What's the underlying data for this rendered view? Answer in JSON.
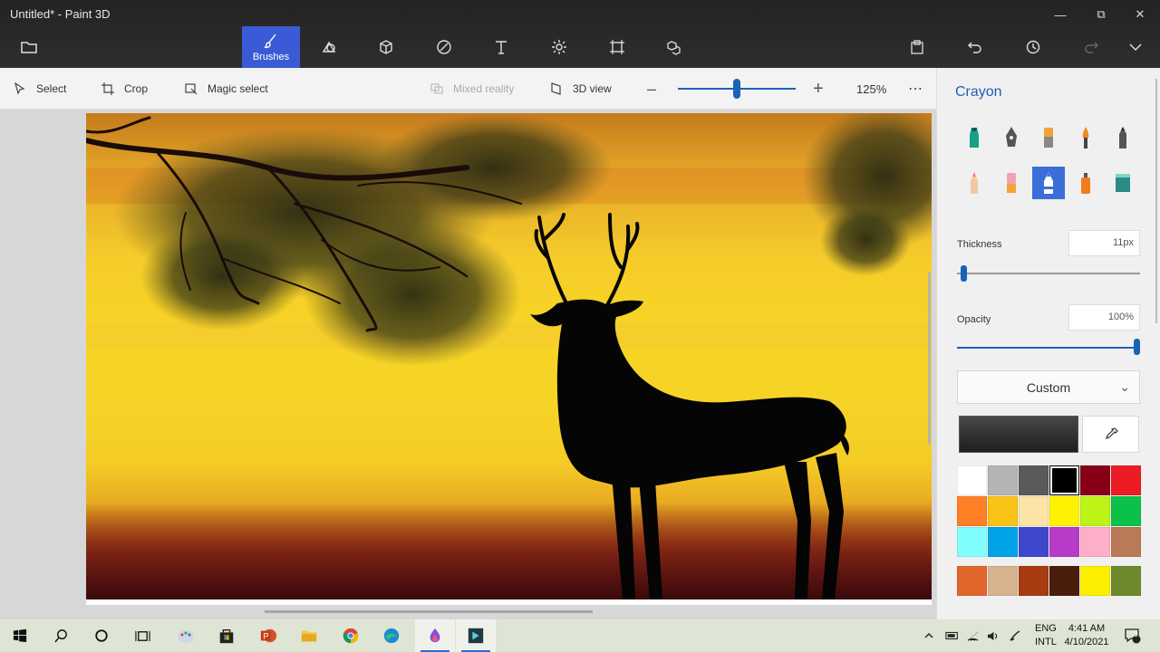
{
  "window": {
    "title": "Untitled* - Paint 3D"
  },
  "toolbar": {
    "brushes_label": "Brushes"
  },
  "subbar": {
    "select": "Select",
    "crop": "Crop",
    "magic_select": "Magic select",
    "mixed_reality": "Mixed reality",
    "view_3d": "3D view",
    "zoom_level": "125%",
    "zoom_fraction": 0.5
  },
  "panel": {
    "title": "Crayon",
    "thickness_label": "Thickness",
    "thickness_value": "11px",
    "thickness_fraction": 0.02,
    "opacity_label": "Opacity",
    "opacity_value": "100%",
    "opacity_fraction": 1.0,
    "palette_dropdown": "Custom",
    "selected_brush": "crayon",
    "current_color": "#1e1e1e",
    "palette": [
      "#ffffff",
      "#b4b4b4",
      "#5a5a5a",
      "#000000",
      "#880015",
      "#ed1c24",
      "#ff7f27",
      "#fbc318",
      "#fde3a6",
      "#fff200",
      "#bdf316",
      "#0cc14a",
      "#80fefe",
      "#00a2e8",
      "#3f48cc",
      "#b73bc7",
      "#ffaec9",
      "#b97a57"
    ],
    "custom_colors": [
      "#e0662c",
      "#d8b48e",
      "#a63c10",
      "#4a1f0a",
      "#fcf000",
      "#6f8a2d"
    ]
  },
  "taskbar": {
    "lang_top": "ENG",
    "lang_bottom": "INTL",
    "time": "4:41 AM",
    "date": "4/10/2021",
    "notifications": "3"
  },
  "colors": {
    "accent": "#3b5bd6",
    "link": "#1c5fb5"
  }
}
